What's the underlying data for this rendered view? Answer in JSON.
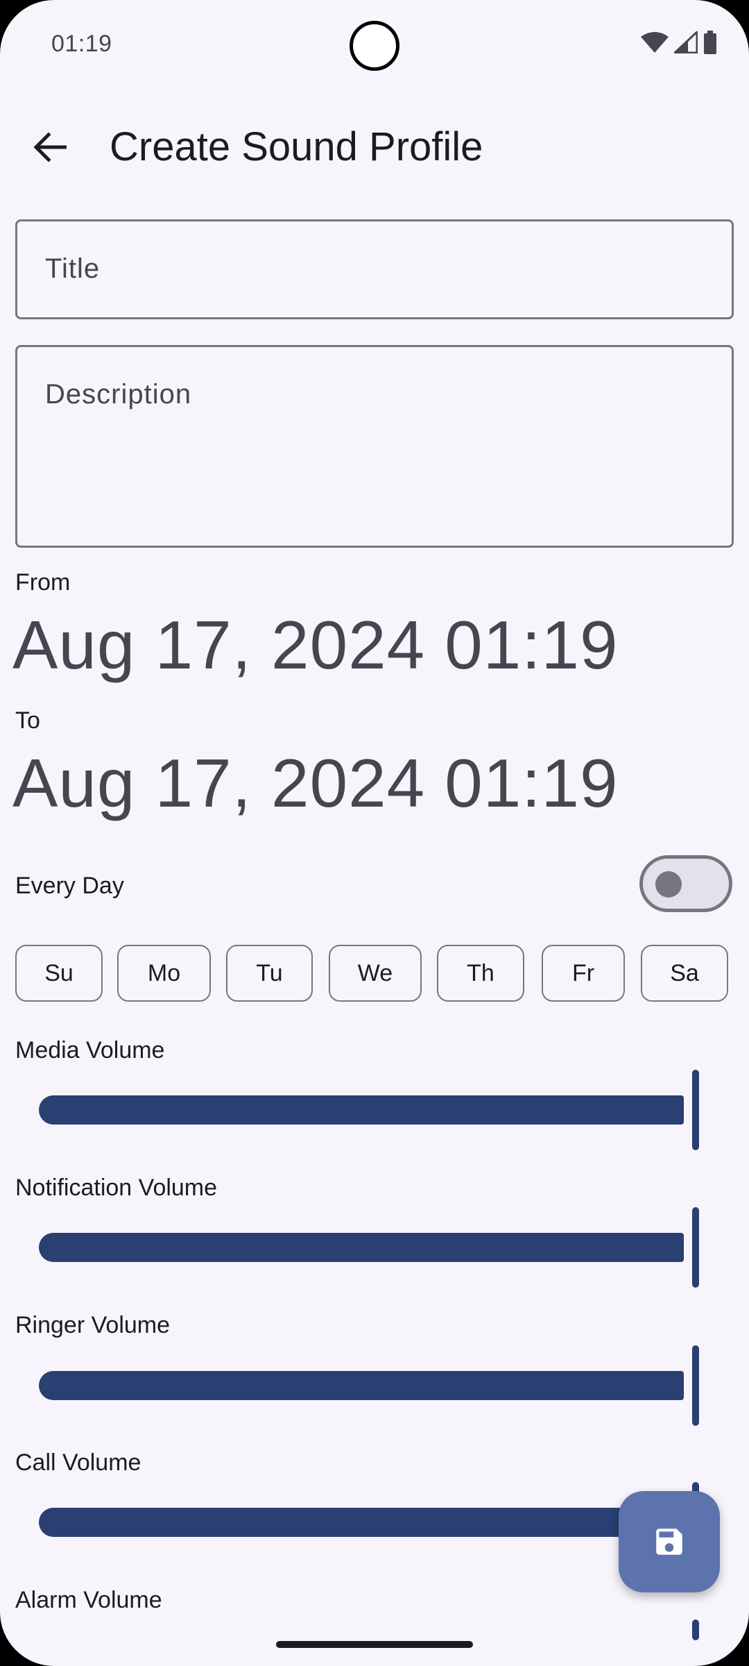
{
  "status_bar": {
    "time": "01:19",
    "icons": [
      "wifi-icon",
      "signal-icon",
      "battery-icon"
    ]
  },
  "app_bar": {
    "back_icon": "arrow-back-icon",
    "title": "Create Sound Profile"
  },
  "form": {
    "title_placeholder": "Title",
    "title_value": "",
    "description_placeholder": "Description",
    "description_value": ""
  },
  "schedule": {
    "from_label": "From",
    "from_value": "Aug 17, 2024 01:19",
    "to_label": "To",
    "to_value": "Aug 17, 2024 01:19",
    "every_day_label": "Every Day",
    "every_day_on": false,
    "days": [
      {
        "label": "Su",
        "selected": false
      },
      {
        "label": "Mo",
        "selected": false
      },
      {
        "label": "Tu",
        "selected": false
      },
      {
        "label": "We",
        "selected": false
      },
      {
        "label": "Th",
        "selected": false
      },
      {
        "label": "Fr",
        "selected": false
      },
      {
        "label": "Sa",
        "selected": false
      }
    ]
  },
  "volumes": [
    {
      "label": "Media Volume",
      "level": 1.0
    },
    {
      "label": "Notification Volume",
      "level": 1.0
    },
    {
      "label": "Ringer Volume",
      "level": 1.0
    },
    {
      "label": "Call Volume",
      "level": 1.0
    },
    {
      "label": "Alarm Volume",
      "level": 1.0
    }
  ],
  "fab": {
    "icon": "save-icon"
  },
  "colors": {
    "accent": "#2a3f72",
    "fab": "#5c73ad",
    "background": "#f7f5fb"
  }
}
